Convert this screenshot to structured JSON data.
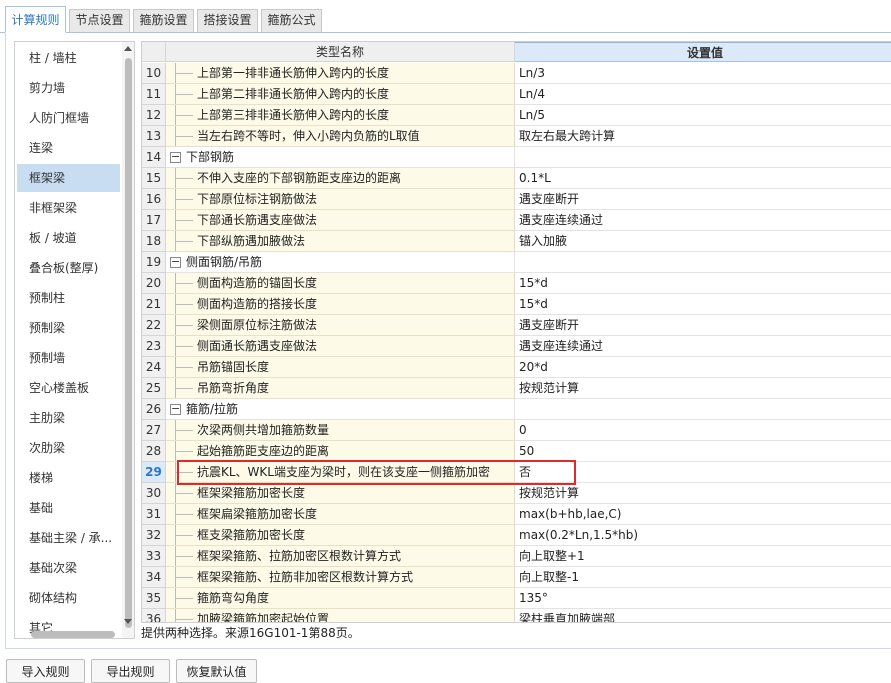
{
  "tabs": [
    "计算规则",
    "节点设置",
    "箍筋设置",
    "搭接设置",
    "箍筋公式"
  ],
  "active_tab": "计算规则",
  "categories": [
    "柱 / 墙柱",
    "剪力墙",
    "人防门框墙",
    "连梁",
    "框架梁",
    "非框架梁",
    "板 / 坡道",
    "叠合板(整厚)",
    "预制柱",
    "预制梁",
    "预制墙",
    "空心楼盖板",
    "主肋梁",
    "次肋梁",
    "楼梯",
    "基础",
    "基础主梁 / 承...",
    "基础次梁",
    "砌体结构",
    "其它"
  ],
  "selected_category": "框架梁",
  "grid": {
    "header_name": "类型名称",
    "header_value": "设置值",
    "rows": [
      {
        "num": "10",
        "name": "上部第一排非通长筋伸入跨内的长度",
        "value": "Ln/3"
      },
      {
        "num": "11",
        "name": "上部第二排非通长筋伸入跨内的长度",
        "value": "Ln/4"
      },
      {
        "num": "12",
        "name": "上部第三排非通长筋伸入跨内的长度",
        "value": "Ln/5"
      },
      {
        "num": "13",
        "name": "当左右跨不等时，伸入小跨内负筋的L取值",
        "value": "取左右最大跨计算"
      },
      {
        "num": "14",
        "name": "下部钢筋",
        "value": "",
        "group": true
      },
      {
        "num": "15",
        "name": "不伸入支座的下部钢筋距支座边的距离",
        "value": "0.1*L"
      },
      {
        "num": "16",
        "name": "下部原位标注钢筋做法",
        "value": "遇支座断开"
      },
      {
        "num": "17",
        "name": "下部通长筋遇支座做法",
        "value": "遇支座连续通过"
      },
      {
        "num": "18",
        "name": "下部纵筋遇加腋做法",
        "value": "锚入加腋"
      },
      {
        "num": "19",
        "name": "侧面钢筋/吊筋",
        "value": "",
        "group": true
      },
      {
        "num": "20",
        "name": "侧面构造筋的锚固长度",
        "value": "15*d"
      },
      {
        "num": "21",
        "name": "侧面构造筋的搭接长度",
        "value": "15*d"
      },
      {
        "num": "22",
        "name": "梁侧面原位标注筋做法",
        "value": "遇支座断开"
      },
      {
        "num": "23",
        "name": "侧面通长筋遇支座做法",
        "value": "遇支座连续通过"
      },
      {
        "num": "24",
        "name": "吊筋锚固长度",
        "value": "20*d"
      },
      {
        "num": "25",
        "name": "吊筋弯折角度",
        "value": "按规范计算"
      },
      {
        "num": "26",
        "name": "箍筋/拉筋",
        "value": "",
        "group": true
      },
      {
        "num": "27",
        "name": "次梁两侧共增加箍筋数量",
        "value": "0"
      },
      {
        "num": "28",
        "name": "起始箍筋距支座边的距离",
        "value": "50"
      },
      {
        "num": "29",
        "name": "抗震KL、WKL端支座为梁时，则在该支座一侧箍筋加密",
        "value": "否",
        "current": true
      },
      {
        "num": "30",
        "name": "框架梁箍筋加密长度",
        "value": "按规范计算"
      },
      {
        "num": "31",
        "name": "框架扁梁箍筋加密长度",
        "value": "max(b+hb,lae,C)"
      },
      {
        "num": "32",
        "name": "框支梁箍筋加密长度",
        "value": "max(0.2*Ln,1.5*hb)"
      },
      {
        "num": "33",
        "name": "框架梁箍筋、拉筋加密区根数计算方式",
        "value": "向上取整+1"
      },
      {
        "num": "34",
        "name": "框架梁箍筋、拉筋非加密区根数计算方式",
        "value": "向上取整-1"
      },
      {
        "num": "35",
        "name": "箍筋弯勾角度",
        "value": "135°"
      },
      {
        "num": "36",
        "name": "加腋梁箍筋加密起始位置",
        "value": "梁柱垂直加腋端部"
      }
    ]
  },
  "description": "提供两种选择。来源16G101-1第88页。",
  "buttons": {
    "import": "导入规则",
    "export": "导出规则",
    "restore": "恢复默认值"
  },
  "colors": {
    "accent": "#2b78c5",
    "highlight_border": "#e0292d",
    "name_cell_bg": "#fdfbe8",
    "selected_bg": "#c8dcf2"
  }
}
